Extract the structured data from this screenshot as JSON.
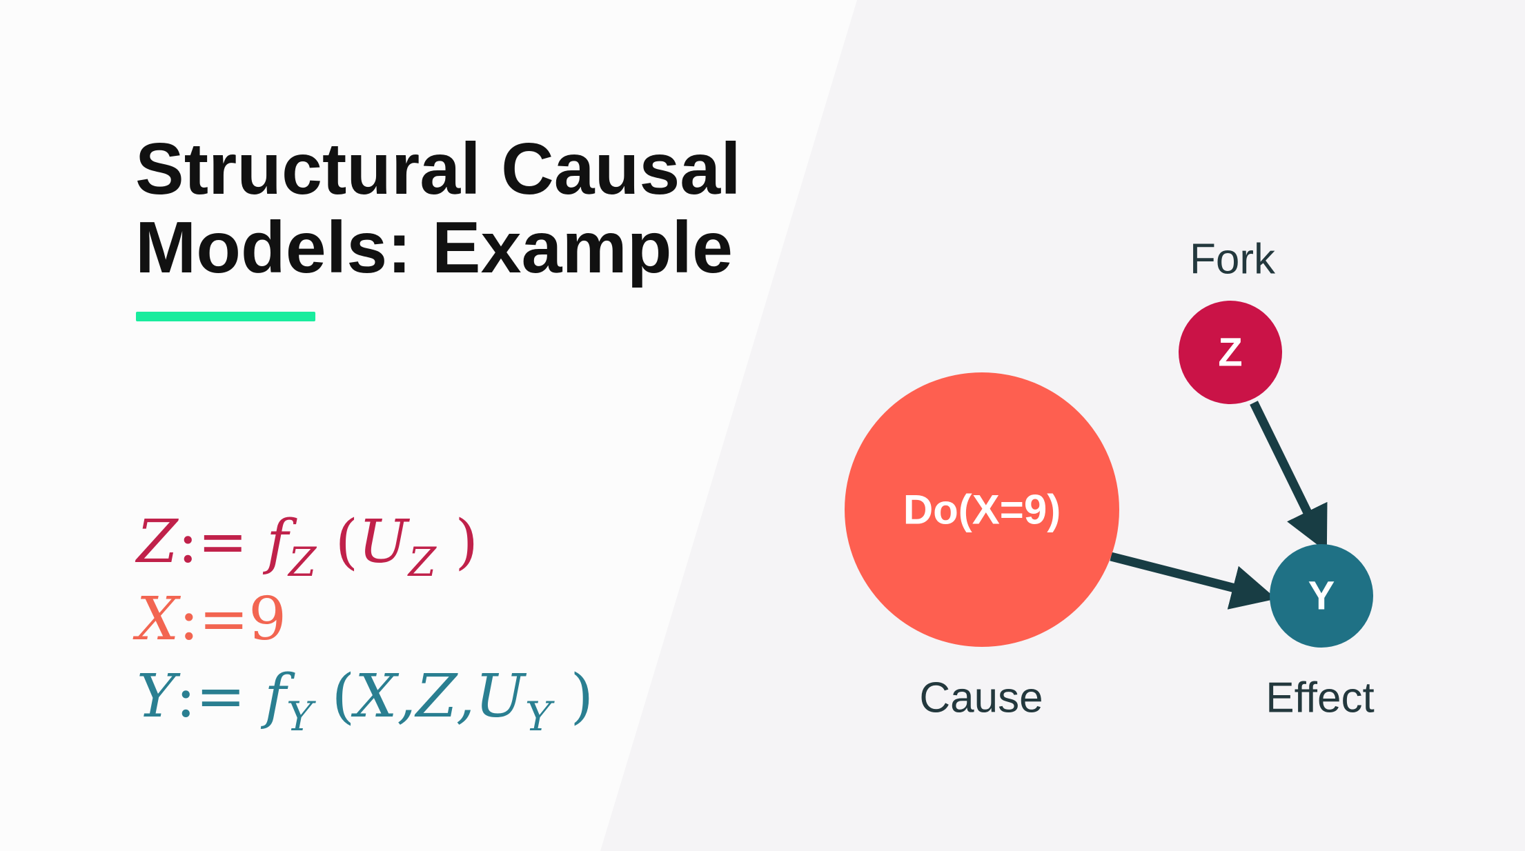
{
  "slide": {
    "title_line1": "Structural Causal",
    "title_line2": "Models: Example"
  },
  "equations": [
    {
      "var": "Z",
      "assign": ":=",
      "func": "f",
      "func_sub": "Z",
      "open": "(",
      "args": [
        {
          "name": "U",
          "sub": "Z"
        }
      ],
      "close": ")",
      "color": "#c0214a"
    },
    {
      "var": "X",
      "assign": ":=",
      "value": "9",
      "color": "#f26551"
    },
    {
      "var": "Y",
      "assign": ":=",
      "func": "f",
      "func_sub": "Y",
      "open": "(",
      "args_text": "X,Z,",
      "last_arg": {
        "name": "U",
        "sub": "Y"
      },
      "close": ")",
      "color": "#2a7f91"
    }
  ],
  "diagram": {
    "fork_label": "Fork",
    "cause_label": "Cause",
    "effect_label": "Effect",
    "nodes": {
      "intervention": {
        "label": "Do(X=9)",
        "color": "#fe5f50"
      },
      "z": {
        "label": "Z",
        "color": "#ca1347"
      },
      "y": {
        "label": "Y",
        "color": "#1f7185"
      }
    },
    "arrow_color": "#183d44",
    "label_color": "#23383d"
  },
  "colors": {
    "accent_bar": "#19ec9e",
    "title": "#111111",
    "background_left": "#fcfcfc",
    "background_right": "#f5f4f6"
  }
}
